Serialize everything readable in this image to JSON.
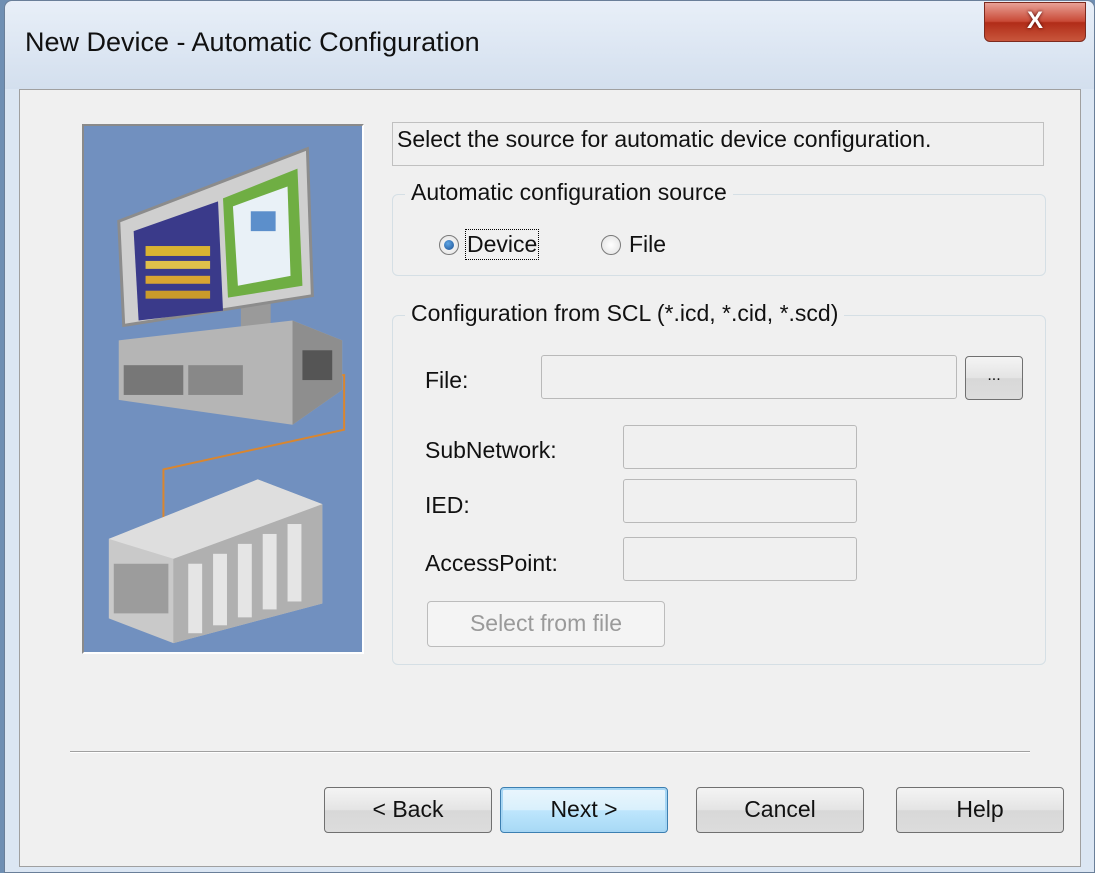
{
  "window": {
    "title": "New Device - Automatic Configuration",
    "close_glyph": "X"
  },
  "description": "Select the source for automatic device configuration.",
  "source_group": {
    "legend": "Automatic configuration source",
    "options": [
      {
        "label": "Device",
        "checked": true
      },
      {
        "label": "File",
        "checked": false
      }
    ]
  },
  "scl_group": {
    "legend": "Configuration from SCL (*.icd, *.cid, *.scd)",
    "file_label": "File:",
    "file_value": "",
    "browse_label": "...",
    "subnetwork_label": "SubNetwork:",
    "subnetwork_value": "",
    "ied_label": "IED:",
    "ied_value": "",
    "accesspoint_label": "AccessPoint:",
    "accesspoint_value": "",
    "select_button": "Select from file"
  },
  "buttons": {
    "back": "< Back",
    "next": "Next >",
    "cancel": "Cancel",
    "help": "Help"
  },
  "icons": {
    "illustration": "pc-and-plc-illustration",
    "close": "close-icon"
  }
}
